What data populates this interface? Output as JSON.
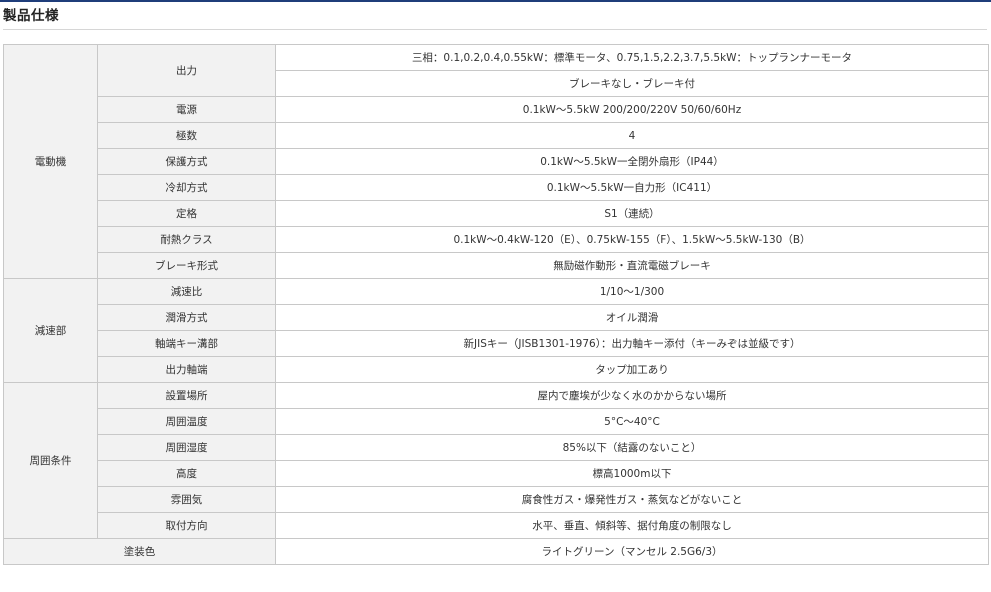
{
  "heading": "製品仕様",
  "groups": {
    "motor": "電動機",
    "reducer": "減速部",
    "environment": "周囲条件",
    "paint_color": "塗装色"
  },
  "rows": {
    "output": {
      "label": "出力",
      "value_1": "三相：0.1,0.2,0.4,0.55kW：標準モータ、0.75,1.5,2.2,3.7,5.5kW：トップランナーモータ",
      "value_2": "ブレーキなし・ブレーキ付"
    },
    "power": {
      "label": "電源",
      "value": "0.1kW～5.5kW 200/200/220V 50/60/60Hz"
    },
    "poles": {
      "label": "極数",
      "value": "4"
    },
    "protection": {
      "label": "保護方式",
      "value": "0.1kW～5.5kW一全閉外扇形（IP44）"
    },
    "cooling": {
      "label": "冷却方式",
      "value": "0.1kW～5.5kW一自力形（IC411）"
    },
    "rating": {
      "label": "定格",
      "value": "S1（連続）"
    },
    "heat_class": {
      "label": "耐熱クラス",
      "value": "0.1kW～0.4kW-120（E）、0.75kW-155（F）、1.5kW～5.5kW-130（B）"
    },
    "brake_type": {
      "label": "ブレーキ形式",
      "value": "無励磁作動形・直流電磁ブレーキ"
    },
    "ratio": {
      "label": "減速比",
      "value": "1/10～1/300"
    },
    "lubrication": {
      "label": "潤滑方式",
      "value": "オイル潤滑"
    },
    "shaft_key": {
      "label": "軸端キー溝部",
      "value": "新JISキー（JISB1301-1976）：出力軸キー添付（キーみぞは並級です）"
    },
    "output_shaft_end": {
      "label": "出力軸端",
      "value": "タップ加工あり"
    },
    "location": {
      "label": "設置場所",
      "value": "屋内で塵埃が少なく水のかからない場所"
    },
    "ambient_temp": {
      "label": "周囲温度",
      "value": "5°C～40°C"
    },
    "ambient_humidity": {
      "label": "周囲湿度",
      "value": "85%以下（結露のないこと）"
    },
    "altitude": {
      "label": "高度",
      "value": "標高1000m以下"
    },
    "atmosphere": {
      "label": "雰囲気",
      "value": "腐食性ガス・爆発性ガス・蒸気などがないこと"
    },
    "mounting": {
      "label": "取付方向",
      "value": "水平、垂直、傾斜等、据付角度の制限なし"
    },
    "paint": {
      "value": "ライトグリーン（マンセル 2.5G6/3）"
    }
  }
}
